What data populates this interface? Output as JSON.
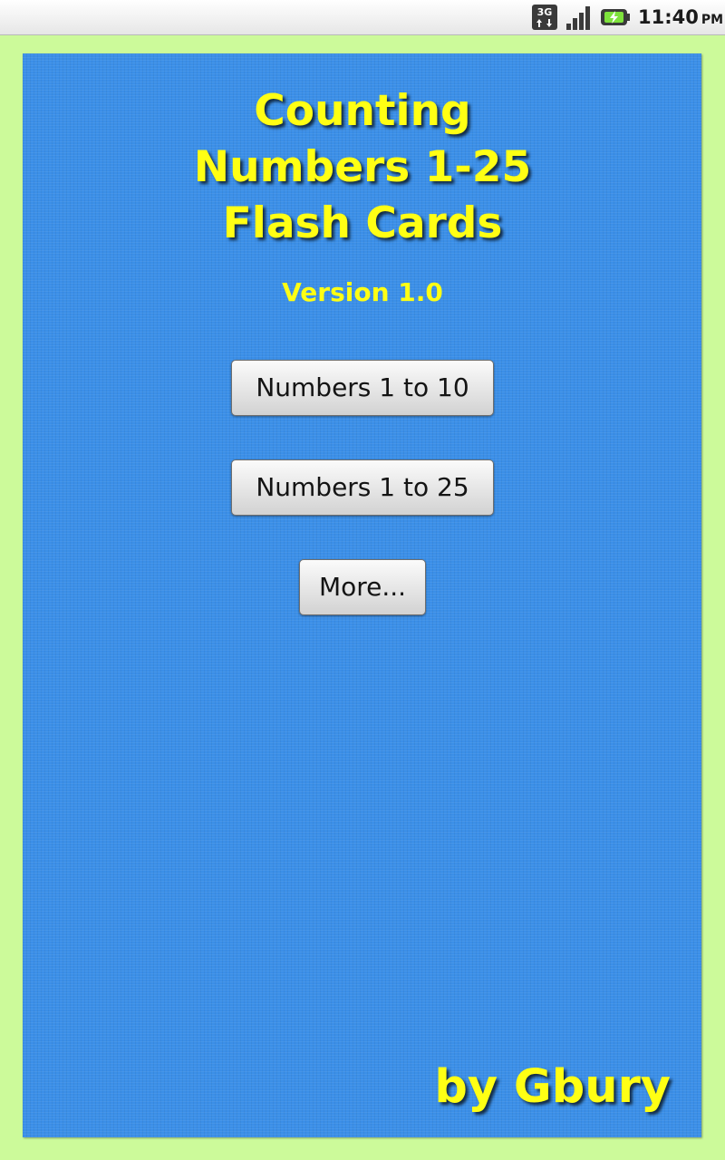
{
  "status_bar": {
    "network_label": "3G",
    "network_icon": "network-3g-icon",
    "signal_icon": "signal-strength-icon",
    "battery_icon": "battery-charging-icon",
    "time": "11:40",
    "ampm": "PM"
  },
  "app": {
    "title_lines": [
      "Counting",
      "Numbers 1-25",
      "Flash Cards"
    ],
    "version": "Version 1.0",
    "author": "by Gbury"
  },
  "buttons": {
    "numbers_1_10": "Numbers 1 to 10",
    "numbers_1_25": "Numbers 1 to 25",
    "more": "More..."
  },
  "colors": {
    "background": "#ccfa9a",
    "panel": "#3b8fe8",
    "title_text": "#ffff14"
  }
}
